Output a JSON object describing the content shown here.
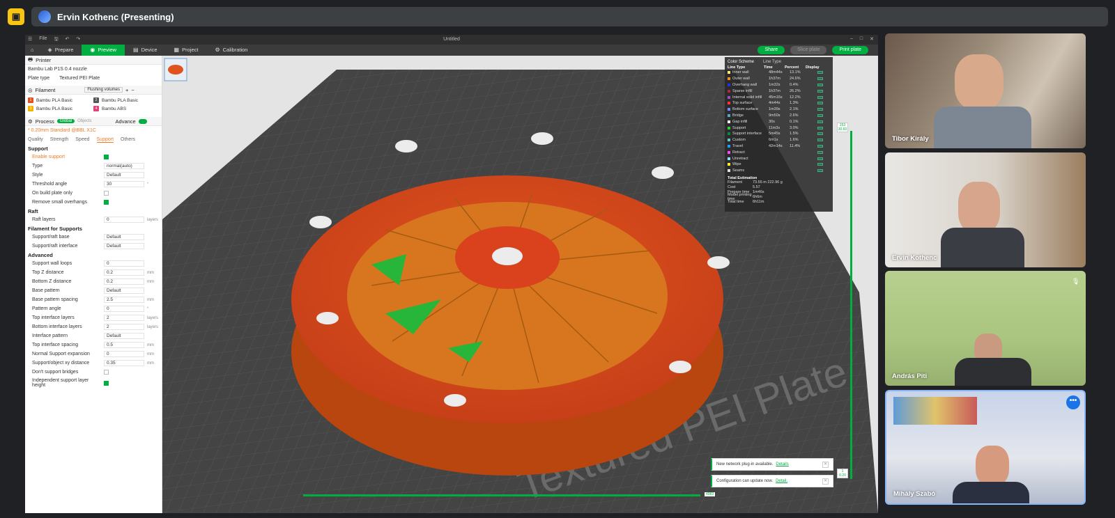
{
  "meet": {
    "presenter_label": "Ervin Kothenc (Presenting)"
  },
  "app": {
    "menu_file": "File",
    "window_title": "Untitled",
    "tabs": [
      {
        "label": "Prepare",
        "icon": "cube-icon"
      },
      {
        "label": "Preview",
        "icon": "preview-icon"
      },
      {
        "label": "Device",
        "icon": "device-icon"
      },
      {
        "label": "Project",
        "icon": "project-icon"
      },
      {
        "label": "Calibration",
        "icon": "calibration-icon"
      }
    ],
    "share_label": "Share",
    "slice_plate_label": "Slice plate",
    "print_plate_label": "Print plate"
  },
  "sidebar": {
    "printer_title": "Printer",
    "printer_name": "Bambu Lab P1S 0.4 nozzle",
    "plate_type_label": "Plate type",
    "plate_type_value": "Textured PEI Plate",
    "filament_title": "Filament",
    "flushing_label": "Flushing volumes",
    "filaments": [
      {
        "num": "1",
        "name": "Bambu PLA Basic",
        "color": "#e0531f"
      },
      {
        "num": "2",
        "name": "Bambu PLA Basic",
        "color": "#555555"
      },
      {
        "num": "3",
        "name": "Bambu PLA Basic",
        "color": "#f2b400"
      },
      {
        "num": "4",
        "name": "Bambu ABS",
        "color": "#e0437a"
      }
    ],
    "process_title": "Process",
    "process_global": "Global",
    "process_objects": "Objects",
    "advance_label": "Advance",
    "process_preset": "* 0.20mm Standard @BBL X1C",
    "subtabs": [
      "Quality",
      "Strength",
      "Speed",
      "Support",
      "Others"
    ],
    "support_head": "Support",
    "enable_support": "Enable support",
    "settings_support": [
      {
        "label": "Type",
        "value": "normal(auto)",
        "unit": ""
      },
      {
        "label": "Style",
        "value": "Default",
        "unit": ""
      },
      {
        "label": "Threshold angle",
        "value": "30",
        "unit": "°"
      },
      {
        "label": "On build plate only",
        "value": "",
        "unit": ""
      },
      {
        "label": "Remove small overhangs",
        "value": "",
        "unit": ""
      }
    ],
    "raft_head": "Raft",
    "raft_layers_label": "Raft layers",
    "raft_layers_value": "0",
    "raft_layers_unit": "layers",
    "filament_supports_head": "Filament for Supports",
    "support_raft_base_label": "Support/raft base",
    "support_raft_base_value": "Default",
    "support_raft_interface_label": "Support/raft interface",
    "support_raft_interface_value": "Default",
    "advanced_head": "Advanced",
    "settings_advanced": [
      {
        "label": "Support wall loops",
        "value": "0",
        "unit": ""
      },
      {
        "label": "Top Z distance",
        "value": "0.2",
        "unit": "mm"
      },
      {
        "label": "Bottom Z distance",
        "value": "0.2",
        "unit": "mm"
      },
      {
        "label": "Base pattern",
        "value": "Default",
        "unit": ""
      },
      {
        "label": "Base pattern spacing",
        "value": "2.5",
        "unit": "mm"
      },
      {
        "label": "Pattern angle",
        "value": "0",
        "unit": "°"
      },
      {
        "label": "Top interface layers",
        "value": "2",
        "unit": "layers"
      },
      {
        "label": "Bottom interface layers",
        "value": "2",
        "unit": "layers"
      },
      {
        "label": "Interface pattern",
        "value": "Default",
        "unit": ""
      },
      {
        "label": "Top interface spacing",
        "value": "0.5",
        "unit": "mm"
      },
      {
        "label": "Normal Support expansion",
        "value": "0",
        "unit": "mm"
      },
      {
        "label": "Support/object xy distance",
        "value": "0.35",
        "unit": "mm"
      }
    ],
    "dont_support_bridges": "Don't support bridges",
    "independent_height": "Independent support layer height"
  },
  "legend": {
    "title": "Color Scheme",
    "scheme": "Line Type",
    "col_type": "Line Type",
    "col_time": "Time",
    "col_pct": "Percent",
    "col_disp": "Display",
    "rows": [
      {
        "name": "Inner wall",
        "time": "48m44s",
        "pct": "13.1%",
        "color": "#ffe680"
      },
      {
        "name": "Outer wall",
        "time": "1h37m",
        "pct": "24.6%",
        "color": "#ff8c1a"
      },
      {
        "name": "Overhang wall",
        "time": "1m32s",
        "pct": "0.4%",
        "color": "#2233dd"
      },
      {
        "name": "Sparse infill",
        "time": "1h37m",
        "pct": "26.2%",
        "color": "#b3263e"
      },
      {
        "name": "Internal solid infill",
        "time": "45m16s",
        "pct": "12.2%",
        "color": "#9b4dcc"
      },
      {
        "name": "Top surface",
        "time": "4m44s",
        "pct": "1.3%",
        "color": "#ff3333"
      },
      {
        "name": "Bottom surface",
        "time": "1m39s",
        "pct": "2.1%",
        "color": "#6b8cff"
      },
      {
        "name": "Bridge",
        "time": "9m50s",
        "pct": "2.6%",
        "color": "#55a8c8"
      },
      {
        "name": "Gap infill",
        "time": "30s",
        "pct": "0.1%",
        "color": "#ffffff"
      },
      {
        "name": "Support",
        "time": "11m3s",
        "pct": "3.0%",
        "color": "#2ecc40"
      },
      {
        "name": "Support interface",
        "time": "5m45s",
        "pct": "1.5%",
        "color": "#0c8a3c"
      },
      {
        "name": "Custom",
        "time": "6m1s",
        "pct": "1.6%",
        "color": "#5fc8c8"
      },
      {
        "name": "Travel",
        "time": "42m14s",
        "pct": "11.4%",
        "color": "#2299ff"
      },
      {
        "name": "Retract",
        "time": "",
        "pct": "",
        "color": "#ff44ff"
      },
      {
        "name": "Unretract",
        "time": "",
        "pct": "",
        "color": "#88ddff"
      },
      {
        "name": "Wipe",
        "time": "",
        "pct": "",
        "color": "#ffee33"
      },
      {
        "name": "Seams",
        "time": "",
        "pct": "",
        "color": "#e0e0e0"
      }
    ],
    "total_title": "Total Estimation",
    "totals": [
      {
        "k": "Filament",
        "v": "73.55 m    222.96 g"
      },
      {
        "k": "Cost",
        "v": "5.57"
      },
      {
        "k": "Prepare time",
        "v": "1m46s"
      },
      {
        "k": "Model printing time",
        "v": "6h6m"
      },
      {
        "k": "Total time",
        "v": "6h11m"
      }
    ]
  },
  "viewport": {
    "plate_text": "Textured PEI Plate",
    "top_layer": "153",
    "top_height": "30.60",
    "bottom_layer": "1",
    "bottom_height": "0.20",
    "move_label": "4983"
  },
  "toasts": [
    {
      "text": "New network plug-in available.",
      "link": "Details"
    },
    {
      "text": "Configuration can update now.",
      "link": "Detail."
    }
  ],
  "participants": [
    {
      "name": "Tibor Király"
    },
    {
      "name": "Ervin Kothenc"
    },
    {
      "name": "András Piti"
    },
    {
      "name": "Mihály Szabó"
    }
  ]
}
